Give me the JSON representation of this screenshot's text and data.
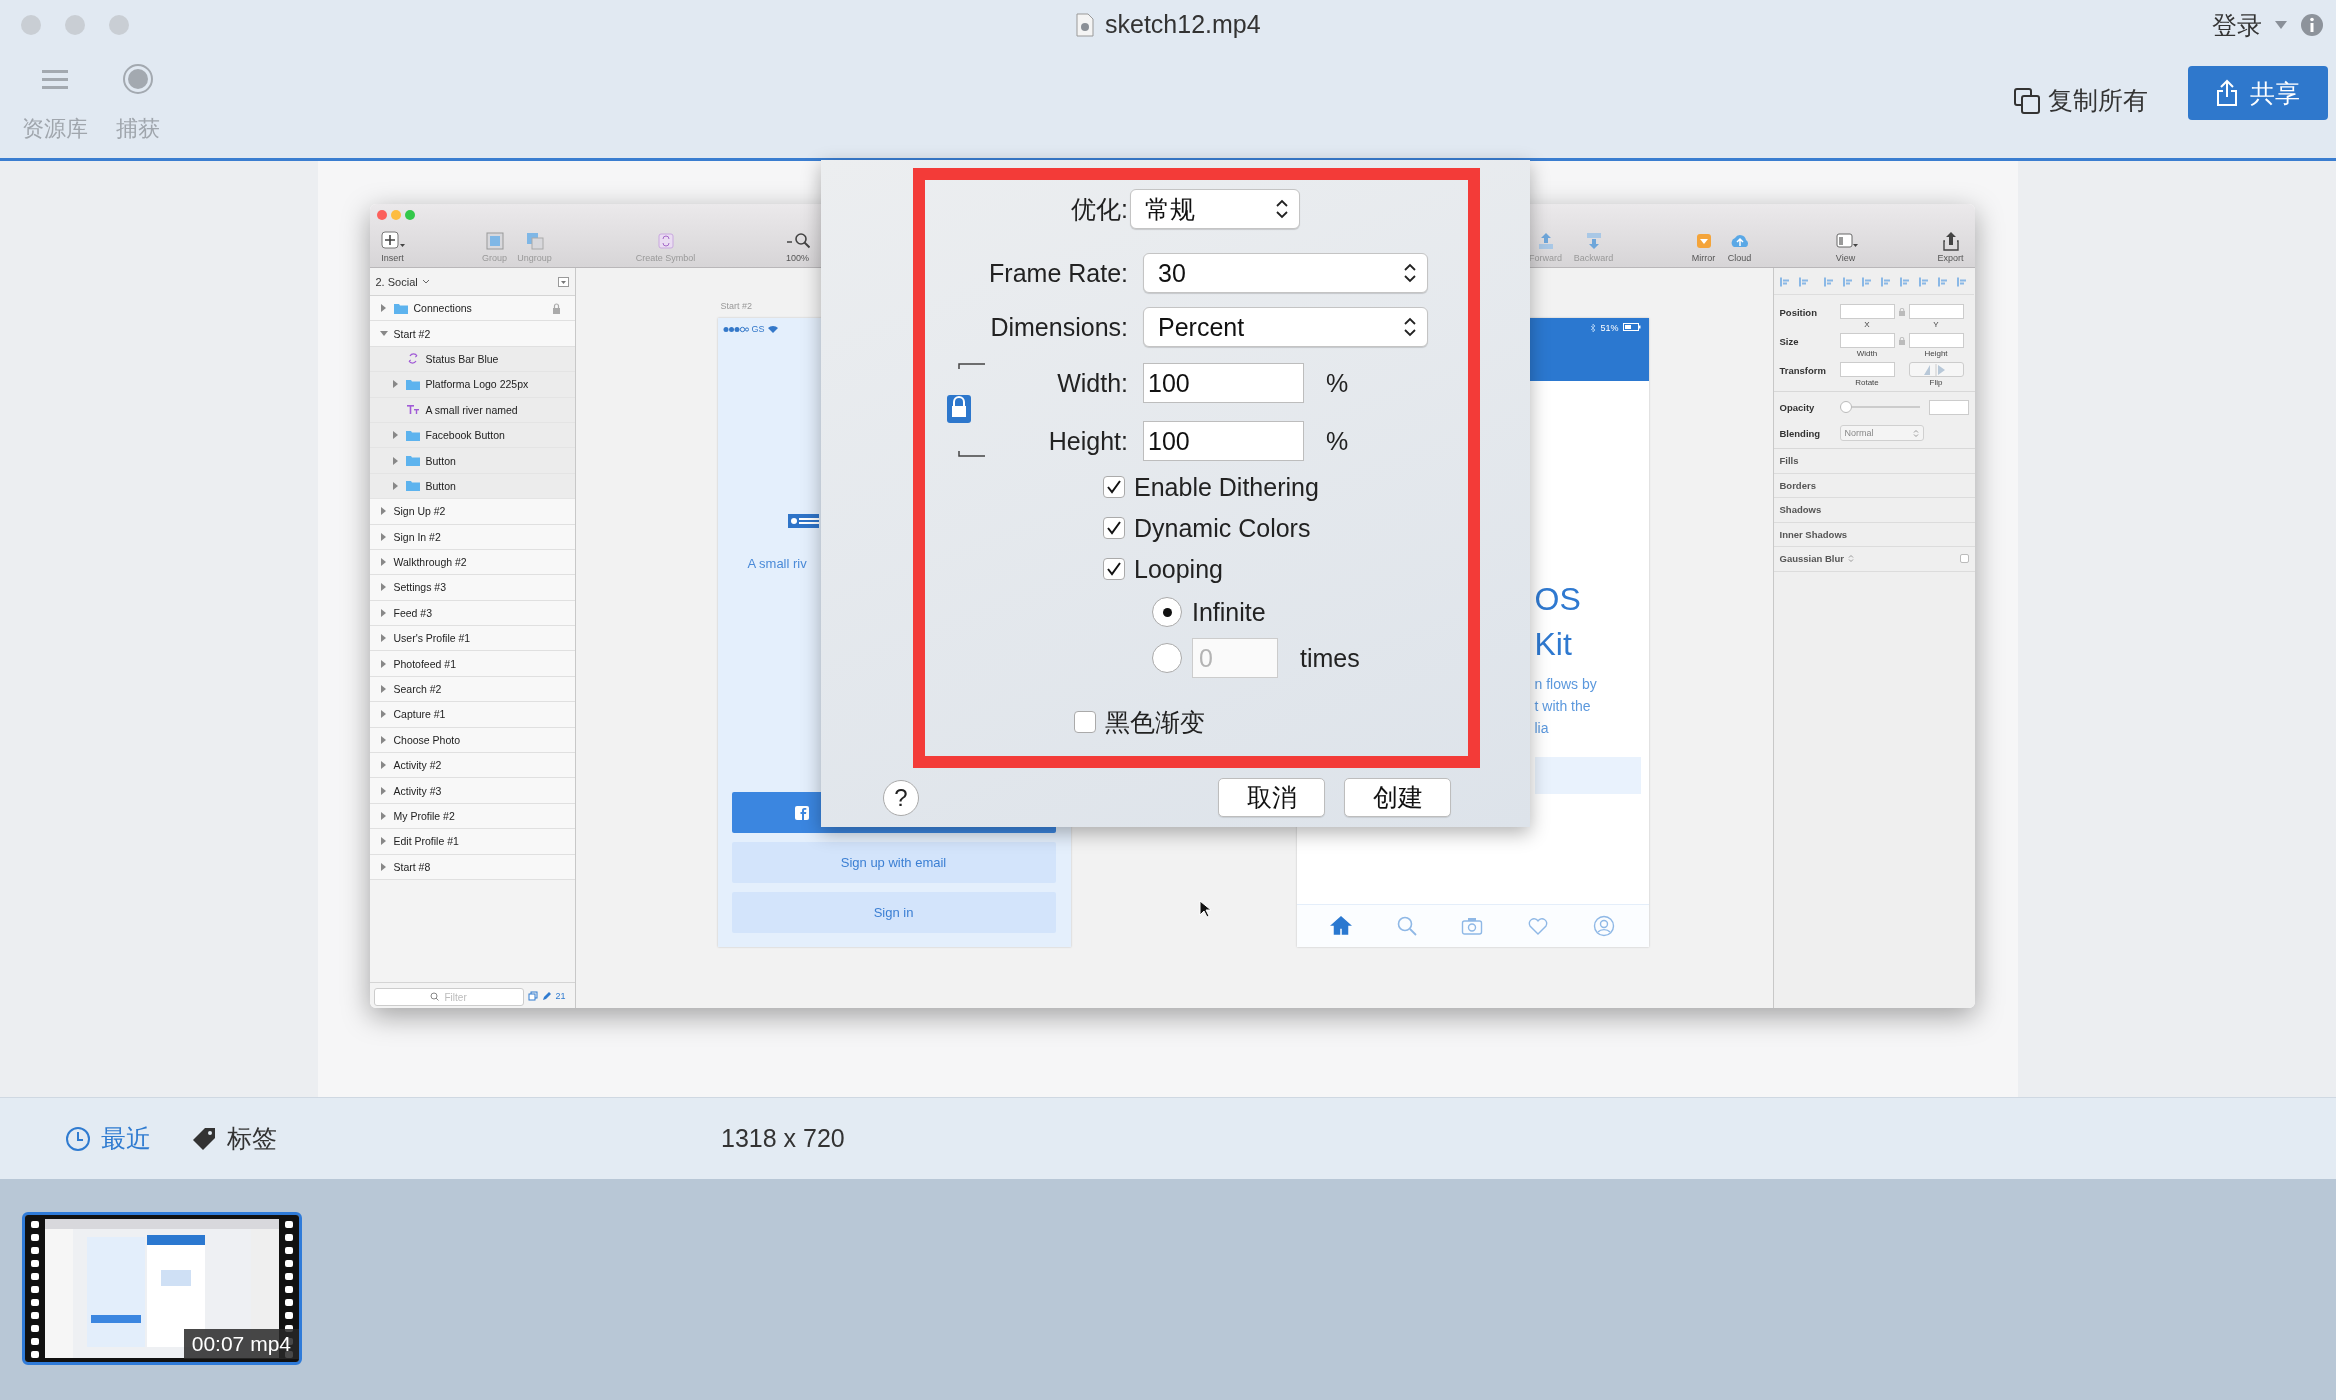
{
  "app": {
    "title": "sketch12.mp4",
    "tools": [
      {
        "label": "资源库",
        "kind": "library"
      },
      {
        "label": "捕获",
        "kind": "capture"
      }
    ],
    "login": "登录",
    "copy_all": "复制所有",
    "share": "共享"
  },
  "sketch": {
    "toolbar": [
      {
        "label": "Insert",
        "kind": "insert"
      },
      {
        "label": "Group",
        "kind": "group"
      },
      {
        "label": "Ungroup",
        "kind": "ungroup"
      },
      {
        "label": "Create Symbol",
        "kind": "symbol"
      },
      {
        "label": "100%",
        "kind": "zoom"
      },
      {
        "label": "Forward",
        "kind": "forward"
      },
      {
        "label": "Backward",
        "kind": "backward"
      },
      {
        "label": "Mirror",
        "kind": "mirror"
      },
      {
        "label": "Cloud",
        "kind": "cloud"
      },
      {
        "label": "View",
        "kind": "view"
      },
      {
        "label": "Export",
        "kind": "export"
      }
    ],
    "page": "2. Social",
    "layers": [
      {
        "name": "Connections",
        "kind": "folder",
        "expanded": false,
        "locked": true
      },
      {
        "name": "Start #2",
        "kind": "artboard",
        "expanded": true,
        "locked": false,
        "children": [
          {
            "name": "Status Bar Blue",
            "kind": "symbol"
          },
          {
            "name": "Platforma Logo 225px",
            "kind": "folder",
            "expanded": false
          },
          {
            "name": "A small river named",
            "kind": "text"
          },
          {
            "name": "Facebook Button",
            "kind": "folder",
            "expanded": false
          },
          {
            "name": "Button",
            "kind": "folder",
            "expanded": false
          },
          {
            "name": "Button",
            "kind": "folder",
            "expanded": false
          }
        ]
      },
      {
        "name": "Sign Up #2",
        "kind": "artboard",
        "expanded": false,
        "locked": false
      },
      {
        "name": "Sign In #2",
        "kind": "artboard",
        "expanded": false,
        "locked": false
      },
      {
        "name": "Walkthrough #2",
        "kind": "artboard",
        "expanded": false,
        "locked": false
      },
      {
        "name": "Settings #3",
        "kind": "artboard",
        "expanded": false,
        "locked": false
      },
      {
        "name": "Feed #3",
        "kind": "artboard",
        "expanded": false,
        "locked": false
      },
      {
        "name": "User's Profile #1",
        "kind": "artboard",
        "expanded": false,
        "locked": false
      },
      {
        "name": "Photofeed #1",
        "kind": "artboard",
        "expanded": false,
        "locked": false
      },
      {
        "name": "Search #2",
        "kind": "artboard",
        "expanded": false,
        "locked": false
      },
      {
        "name": "Capture #1",
        "kind": "artboard",
        "expanded": false,
        "locked": false
      },
      {
        "name": "Choose Photo",
        "kind": "artboard",
        "expanded": false,
        "locked": false
      },
      {
        "name": "Activity #2",
        "kind": "artboard",
        "expanded": false,
        "locked": false
      },
      {
        "name": "Activity #3",
        "kind": "artboard",
        "expanded": false,
        "locked": false
      },
      {
        "name": "My Profile #2",
        "kind": "artboard",
        "expanded": false,
        "locked": false
      },
      {
        "name": "Edit Profile #1",
        "kind": "artboard",
        "expanded": false,
        "locked": false
      },
      {
        "name": "Start #8",
        "kind": "artboard",
        "expanded": false,
        "locked": false
      }
    ],
    "filter_placeholder": "Filter",
    "layer_count": "21",
    "left_artboard": {
      "label": "Start #2",
      "carrier": "GS",
      "caption": "A small riv",
      "buttons": [
        {
          "kind": "facebook"
        },
        {
          "kind": "plain",
          "label": "Sign up with email"
        },
        {
          "kind": "plain",
          "label": "Sign in"
        }
      ]
    },
    "right_artboard": {
      "battery": "51%",
      "title_lines": [
        "OS",
        "Kit"
      ],
      "body_lines": [
        "n flows by",
        "t with the",
        "lia"
      ],
      "tabs": [
        {
          "kind": "home",
          "selected": true
        },
        {
          "kind": "search",
          "selected": false
        },
        {
          "kind": "camera",
          "selected": false
        },
        {
          "kind": "heart",
          "selected": false
        },
        {
          "kind": "profile",
          "selected": false
        }
      ]
    },
    "inspector": {
      "rows": [
        {
          "label": "Position",
          "kind": "pair",
          "captions": [
            "X",
            "Y"
          ]
        },
        {
          "label": "Size",
          "kind": "pair",
          "captions": [
            "Width",
            "Height"
          ]
        },
        {
          "label": "Transform",
          "kind": "transform",
          "captions": [
            "Rotate",
            "Flip"
          ]
        }
      ],
      "opacity": {
        "label": "Opacity",
        "level": 0
      },
      "blending": {
        "label": "Blending",
        "value": "Normal"
      },
      "sections": [
        {
          "label": "Fills",
          "kind": "plain"
        },
        {
          "label": "Borders",
          "kind": "plain"
        },
        {
          "label": "Shadows",
          "kind": "plain"
        },
        {
          "label": "Inner Shadows",
          "kind": "plain"
        },
        {
          "label": "Gaussian Blur",
          "kind": "blur",
          "checked": false
        }
      ]
    }
  },
  "dialog": {
    "rows": [
      {
        "label": "优化:",
        "kind": "select",
        "value": "常规"
      },
      {
        "label": "Frame Rate:",
        "kind": "select",
        "value": "30"
      },
      {
        "label": "Dimensions:",
        "kind": "select",
        "value": "Percent"
      }
    ],
    "size_rows": [
      {
        "label": "Width:",
        "value": "100",
        "unit": "%"
      },
      {
        "label": "Height:",
        "value": "100",
        "unit": "%"
      }
    ],
    "size_locked": true,
    "options": [
      {
        "label": "Enable Dithering",
        "checked": true
      },
      {
        "label": "Dynamic Colors",
        "checked": true
      },
      {
        "label": "Looping",
        "checked": true
      }
    ],
    "loop_modes": [
      {
        "kind": "infinite",
        "label": "Infinite",
        "selected": true
      },
      {
        "kind": "count",
        "value": "0",
        "disabled": true,
        "suffix": "times",
        "selected": false
      }
    ],
    "black_fade": {
      "label": "黑色渐变",
      "checked": false
    },
    "help": "?",
    "buttons": [
      {
        "label": "取消"
      },
      {
        "label": "创建"
      }
    ]
  },
  "bottom_bar": {
    "tabs": [
      {
        "label": "最近",
        "kind": "recent"
      },
      {
        "label": "标签",
        "kind": "tags"
      }
    ],
    "dimensions": "1318 x 720"
  },
  "filmstrip": [
    {
      "label": "00:07 mp4",
      "selected": true
    }
  ]
}
